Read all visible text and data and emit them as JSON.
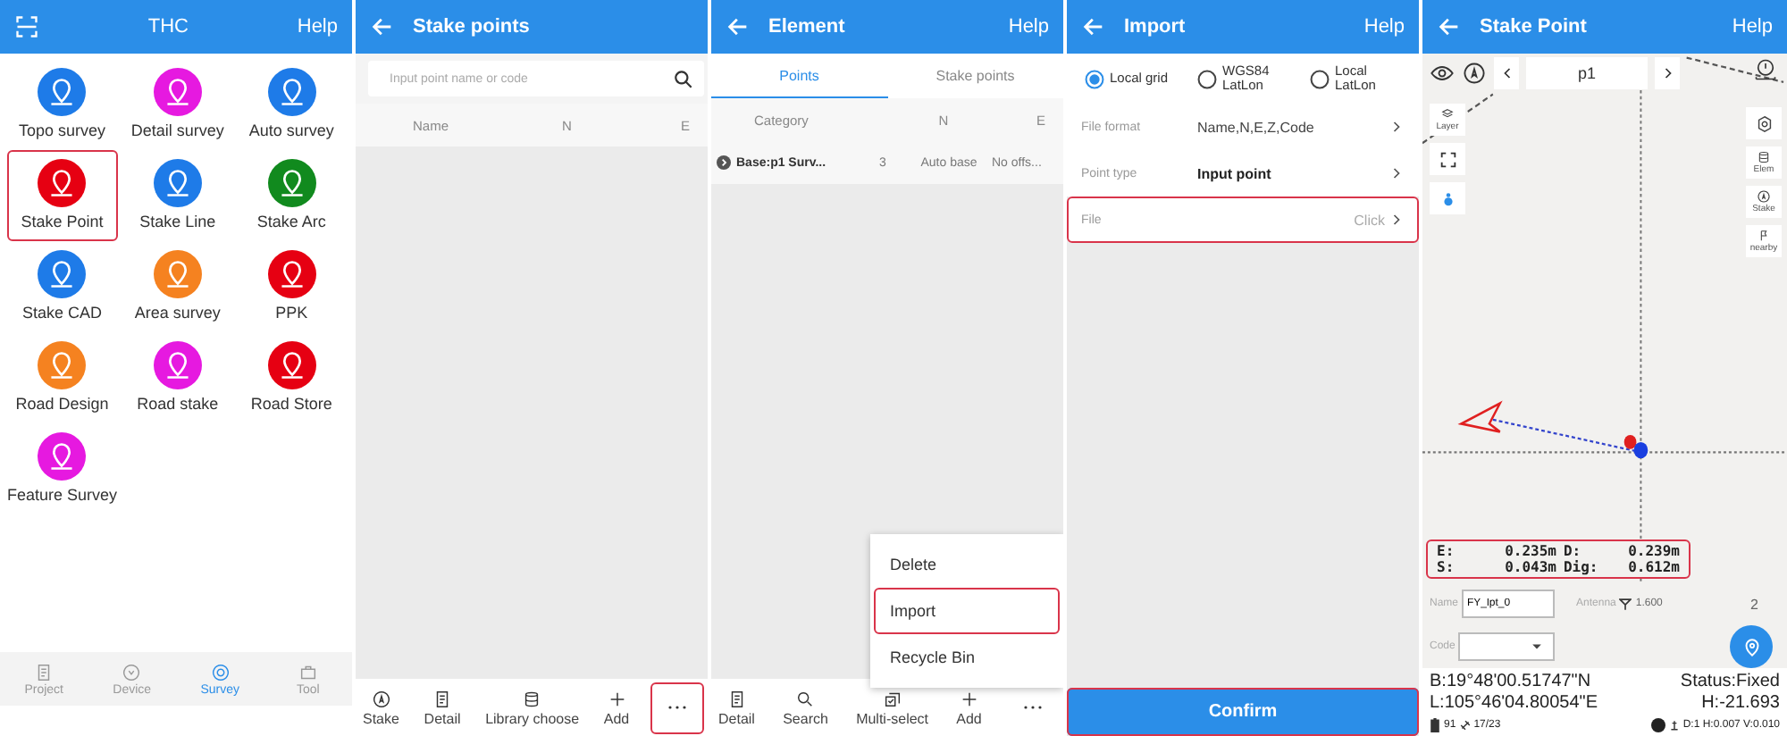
{
  "home": {
    "title": "THC",
    "action": "Help",
    "items": [
      {
        "label": "Topo survey",
        "color": "#1e7be8",
        "highlighted": false
      },
      {
        "label": "Detail survey",
        "color": "#e619e0",
        "highlighted": false
      },
      {
        "label": "Auto survey",
        "color": "#1e7be8",
        "highlighted": false
      },
      {
        "label": "Stake Point",
        "color": "#e60012",
        "highlighted": true
      },
      {
        "label": "Stake Line",
        "color": "#1e7be8",
        "highlighted": false
      },
      {
        "label": "Stake Arc",
        "color": "#118a1e",
        "highlighted": false
      },
      {
        "label": "Stake CAD",
        "color": "#1e7be8",
        "highlighted": false
      },
      {
        "label": "Area survey",
        "color": "#f58220",
        "highlighted": false
      },
      {
        "label": "PPK",
        "color": "#e60012",
        "highlighted": false
      },
      {
        "label": "Road Design",
        "color": "#f58220",
        "highlighted": false
      },
      {
        "label": "Road stake",
        "color": "#e619e0",
        "highlighted": false
      },
      {
        "label": "Road Store",
        "color": "#e60012",
        "highlighted": false
      },
      {
        "label": "Feature Survey",
        "color": "#e619e0",
        "highlighted": false
      }
    ],
    "nav": [
      {
        "label": "Project",
        "selected": false
      },
      {
        "label": "Device",
        "selected": false
      },
      {
        "label": "Survey",
        "selected": true
      },
      {
        "label": "Tool",
        "selected": false
      }
    ]
  },
  "stake_points": {
    "title": "Stake points",
    "search": {
      "placeholder": "Input point name or code"
    },
    "columns": [
      "Name",
      "N",
      "E"
    ],
    "toolbar": [
      {
        "label": "Stake"
      },
      {
        "label": "Detail"
      },
      {
        "label": "Library choose"
      },
      {
        "label": "Add"
      }
    ],
    "more": {
      "highlighted": true
    }
  },
  "element": {
    "title": "Element",
    "action": "Help",
    "tabs": [
      {
        "label": "Points",
        "selected": true
      },
      {
        "label": "Stake points",
        "selected": false
      }
    ],
    "columns": [
      "Category",
      "",
      "N",
      "E"
    ],
    "rows": [
      {
        "cells": [
          "Base:p1 Surv...",
          "3",
          "Auto base",
          "No offs..."
        ]
      }
    ],
    "menu": [
      {
        "label": "Delete",
        "highlighted": false
      },
      {
        "label": "Import",
        "highlighted": true
      },
      {
        "label": "Recycle Bin",
        "highlighted": false
      }
    ],
    "toolbar": [
      {
        "label": "Detail"
      },
      {
        "label": "Search"
      },
      {
        "label": "Multi-select"
      },
      {
        "label": "Add"
      }
    ]
  },
  "import": {
    "title": "Import",
    "action": "Help",
    "radios": [
      {
        "label": "Local grid",
        "selected": true
      },
      {
        "label": "WGS84 LatLon",
        "selected": false
      },
      {
        "label": "Local LatLon",
        "selected": false
      }
    ],
    "rows": [
      {
        "label": "File format",
        "value": "Name,N,E,Z,Code",
        "strong": false,
        "highlighted": false
      },
      {
        "label": "Point type",
        "value": "Input point",
        "strong": true,
        "highlighted": false
      },
      {
        "label": "File",
        "value": "Click",
        "strong": false,
        "highlighted": true
      }
    ],
    "confirm": {
      "label": "Confirm",
      "highlighted": true
    }
  },
  "stake_map": {
    "title": "Stake Point",
    "action": "Help",
    "point": "p1",
    "left_tools": [
      "Layer"
    ],
    "right_tools": [
      "Elem",
      "Stake",
      "nearby"
    ],
    "readout": {
      "highlighted": true,
      "rows": [
        [
          "E:",
          "0.235m",
          "D:",
          "0.239m"
        ],
        [
          "S:",
          "0.043m",
          "Dig:",
          "0.612m"
        ]
      ]
    },
    "name_label": "Name",
    "name_value": "FY_lpt_0",
    "antenna_label": "Antenna",
    "antenna_value": "1.600",
    "count": "2",
    "code_label": "Code",
    "lat": "B:19°48'00.51747\"N",
    "status": "Status:Fixed",
    "lon": "L:105°46'04.80054\"E",
    "height": "H:-21.693",
    "battery": "91",
    "satellites": "17/23",
    "precision": "D:1 H:0.007 V:0.010"
  }
}
